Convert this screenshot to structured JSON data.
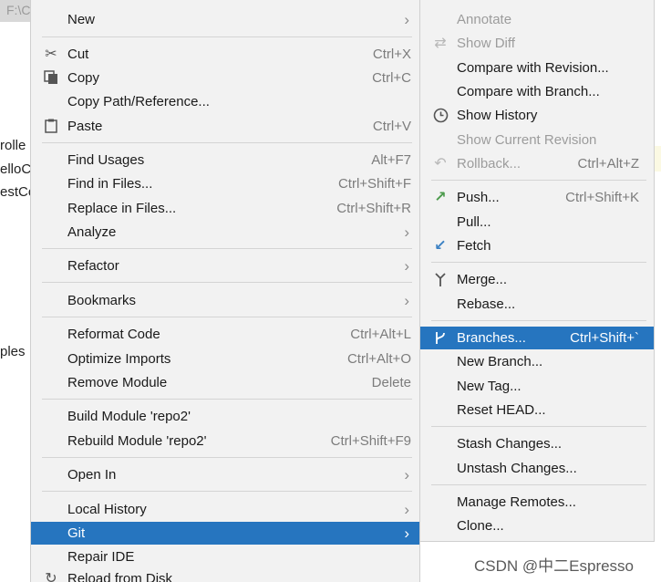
{
  "background": {
    "path": "F:\\C",
    "labels": [
      "rolle",
      "elloC",
      "estCo",
      "ples"
    ]
  },
  "main_menu": {
    "new": "New",
    "cut": "Cut",
    "cut_sc": "Ctrl+X",
    "copy": "Copy",
    "copy_sc": "Ctrl+C",
    "copy_path": "Copy Path/Reference...",
    "paste": "Paste",
    "paste_sc": "Ctrl+V",
    "find_usages": "Find Usages",
    "find_usages_sc": "Alt+F7",
    "find_in_files": "Find in Files...",
    "find_in_files_sc": "Ctrl+Shift+F",
    "replace_in_files": "Replace in Files...",
    "replace_in_files_sc": "Ctrl+Shift+R",
    "analyze": "Analyze",
    "refactor": "Refactor",
    "bookmarks": "Bookmarks",
    "reformat_code": "Reformat Code",
    "reformat_code_sc": "Ctrl+Alt+L",
    "optimize_imports": "Optimize Imports",
    "optimize_imports_sc": "Ctrl+Alt+O",
    "remove_module": "Remove Module",
    "remove_module_sc": "Delete",
    "build_module": "Build Module 'repo2'",
    "rebuild_module": "Rebuild Module 'repo2'",
    "rebuild_module_sc": "Ctrl+Shift+F9",
    "open_in": "Open In",
    "local_history": "Local History",
    "git": "Git",
    "repair_ide": "Repair IDE",
    "reload_from_disk": "Reload from Disk"
  },
  "git_menu": {
    "annotate": "Annotate",
    "show_diff": "Show Diff",
    "compare_revision": "Compare with Revision...",
    "compare_branch": "Compare with Branch...",
    "show_history": "Show History",
    "show_current_revision": "Show Current Revision",
    "rollback": "Rollback...",
    "rollback_sc": "Ctrl+Alt+Z",
    "push": "Push...",
    "push_sc": "Ctrl+Shift+K",
    "pull": "Pull...",
    "fetch": "Fetch",
    "merge": "Merge...",
    "rebase": "Rebase...",
    "branches": "Branches...",
    "branches_sc": "Ctrl+Shift+`",
    "new_branch": "New Branch...",
    "new_tag": "New Tag...",
    "reset_head": "Reset HEAD...",
    "stash": "Stash Changes...",
    "unstash": "Unstash Changes...",
    "manage_remotes": "Manage Remotes...",
    "clone": "Clone..."
  },
  "watermark": "CSDN @中二Espresso"
}
